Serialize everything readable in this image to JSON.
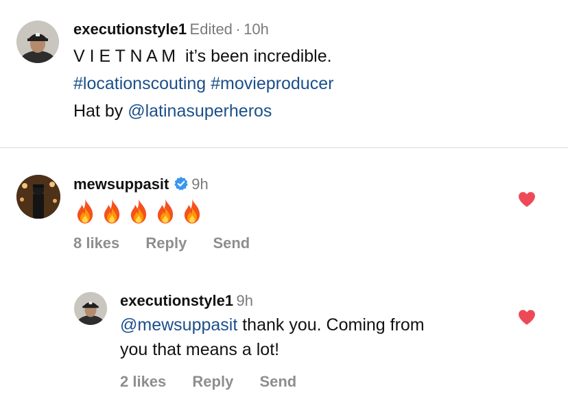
{
  "caption": {
    "username": "executionstyle1",
    "edited": "Edited",
    "separator": "·",
    "time": "10h",
    "line1": "V I E T N A M  it’s been incredible.",
    "hashtag1": "#locationscouting",
    "hashtag2": "#movieproducer",
    "line3_prefix": "Hat by ",
    "mention": "@latinasuperheros"
  },
  "comment": {
    "username": "mewsuppasit",
    "time": "9h",
    "emoji_count": 5,
    "emoji_name": "fire-icon",
    "likes": "8 likes",
    "reply": "Reply",
    "send": "Send",
    "liked": true,
    "heart_color": "#ed4956"
  },
  "reply": {
    "username": "executionstyle1",
    "time": "9h",
    "mention": "@mewsuppasit",
    "text_line1": " thank you. Coming from",
    "text_line2": "you that means a lot!",
    "likes": "2 likes",
    "reply": "Reply",
    "send": "Send",
    "liked": true
  },
  "colors": {
    "link": "#1b4f8a",
    "verified": "#3897f0",
    "muted": "#8e8e8e"
  }
}
